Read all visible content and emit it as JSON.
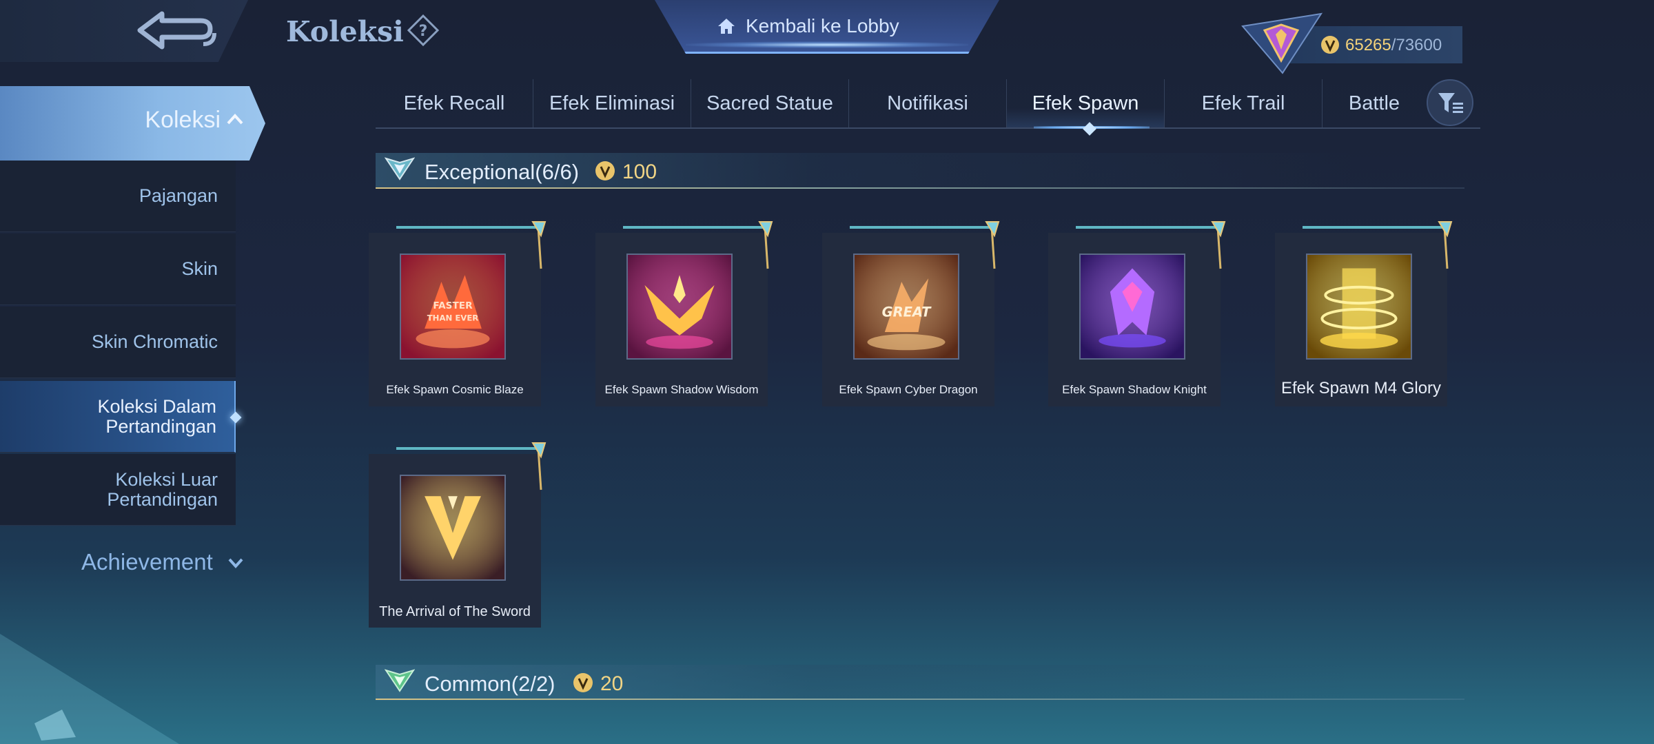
{
  "header": {
    "title": "Koleksi",
    "lobby_label": "Kembali ke Lobby",
    "points_current": "65265",
    "points_separator": "/",
    "points_max": "73600"
  },
  "sidebar": {
    "active": "Koleksi",
    "items": [
      {
        "label": "Pajangan"
      },
      {
        "label": "Skin"
      },
      {
        "label": "Skin Chromatic"
      },
      {
        "label": "Koleksi Dalam Pertandingan",
        "line1": "Koleksi Dalam",
        "line2": "Pertandingan",
        "selected": true
      },
      {
        "label": "Koleksi Luar Pertandingan",
        "line1": "Koleksi Luar",
        "line2": "Pertandingan"
      }
    ],
    "achievement": "Achievement"
  },
  "tabs": [
    {
      "label": "Efek Recall"
    },
    {
      "label": "Efek Eliminasi"
    },
    {
      "label": "Sacred Statue"
    },
    {
      "label": "Notifikasi"
    },
    {
      "label": "Efek Spawn",
      "active": true
    },
    {
      "label": "Efek Trail"
    },
    {
      "label": "Battle"
    }
  ],
  "sections": {
    "exceptional": {
      "title": "Exceptional",
      "count": "(6/6)",
      "cost": "100"
    },
    "common": {
      "title": "Common",
      "count": "(2/2)",
      "cost": "20"
    }
  },
  "items": [
    {
      "label": "Efek Spawn Cosmic Blaze",
      "art_text_1": "FASTER",
      "art_text_2": "THAN EVER",
      "palette": [
        "#ff6a3c",
        "#8a1230"
      ]
    },
    {
      "label": "Efek Spawn Shadow Wisdom",
      "palette": [
        "#ff4fa8",
        "#5a1440"
      ]
    },
    {
      "label": "Efek Spawn Cyber Dragon",
      "art_text_1": "GREAT",
      "palette": [
        "#ffb36a",
        "#5a2a18"
      ]
    },
    {
      "label": "Efek Spawn Shadow Knight",
      "palette": [
        "#b46bff",
        "#2a1460"
      ]
    },
    {
      "label": "Efek Spawn M4 Glory",
      "palette": [
        "#ffe15a",
        "#6a4a08"
      ]
    },
    {
      "label": "The Arrival of The Sword",
      "palette": [
        "#ffd36a",
        "#3a1e26"
      ]
    }
  ],
  "colors": {
    "accent_blue": "#8ab8e6",
    "gold": "#f2d585",
    "panel": "#222b3e"
  },
  "icons": [
    "back-arrow-icon",
    "help-icon",
    "home-icon",
    "rank-emblem-icon",
    "coin-icon",
    "chevron-up-icon",
    "chevron-down-icon",
    "filter-icon",
    "tier-exceptional-icon",
    "tier-common-icon"
  ]
}
